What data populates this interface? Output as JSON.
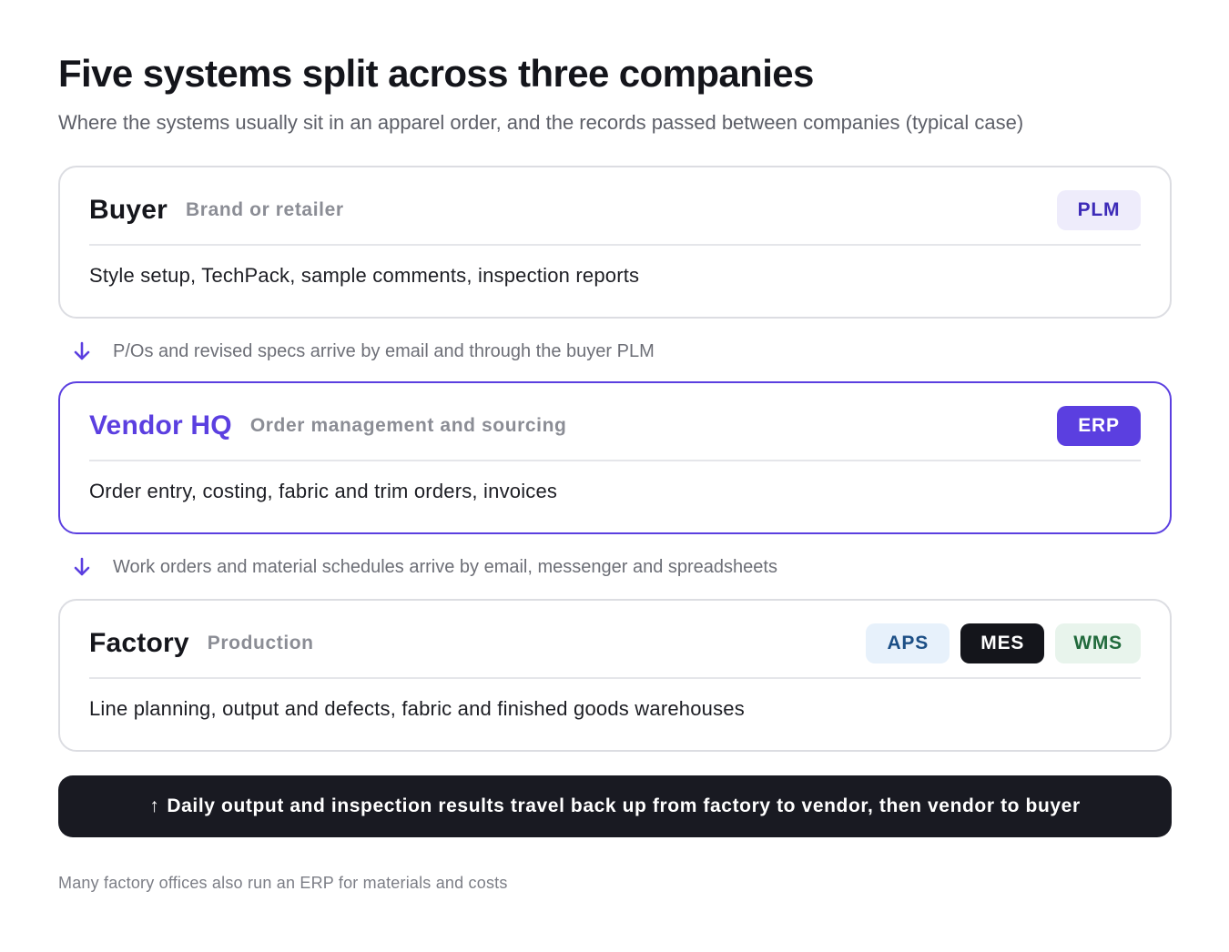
{
  "header": {
    "title": "Five systems split across three companies",
    "subtitle": "Where the systems usually sit in an apparel order, and the records passed between companies (typical case)"
  },
  "cards": {
    "buyer": {
      "name": "Buyer",
      "role": "Brand or retailer",
      "systems": [
        "PLM"
      ],
      "description": "Style setup, TechPack, sample comments, inspection reports"
    },
    "vendor": {
      "name": "Vendor HQ",
      "role": "Order management and sourcing",
      "systems": [
        "ERP"
      ],
      "description": "Order entry, costing, fabric and trim orders, invoices"
    },
    "factory": {
      "name": "Factory",
      "role": "Production",
      "systems": [
        "APS",
        "MES",
        "WMS"
      ],
      "description": "Line planning, output and defects, fabric and finished goods warehouses"
    }
  },
  "flows": {
    "buyer_to_vendor": "P/Os and revised specs arrive by email and through the buyer PLM",
    "vendor_to_factory": "Work orders and material schedules arrive by email, messenger and spreadsheets"
  },
  "return_flow": {
    "arrow": "↑",
    "text": "Daily output and inspection results travel back up from factory to vendor, then vendor to buyer"
  },
  "footnote": "Many factory offices also run an ERP for materials and costs",
  "colors": {
    "accent": "#5b3fe0",
    "dark": "#191a22",
    "border": "#dcdde2"
  }
}
